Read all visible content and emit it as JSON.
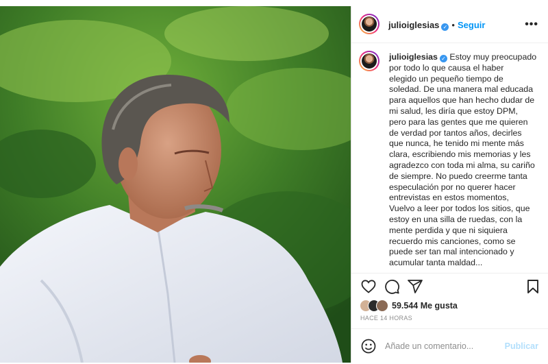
{
  "header": {
    "username": "julioiglesias",
    "separator": "•",
    "follow_label": "Seguir",
    "more_icon": "more-options-icon"
  },
  "caption": {
    "username": "julioiglesias",
    "text": "Estoy muy preocupado\npor todo lo que causa el haber\nelegido un pequeño tiempo de\nsoledad. De una manera mal educada\npara aquellos que han hecho dudar de\nmi salud, les diría que estoy DPM,\npero para las gentes que me quieren\nde verdad por tantos años, decirles\nque nunca, he tenido mi mente más\nclara, escribiendo mis memorias y les\nagradezco con toda mi alma, su cariño\nde siempre. No puedo creerme tanta\nespeculación por no querer hacer\nentrevistas en estos momentos,\nVuelvo a leer por todos los sitios, que\nestoy en una silla de ruedas, con la\nmente perdida y que ni siquiera\nrecuerdo mis canciones, como se\npuede ser tan mal intencionado y\nacumular tanta maldad..."
  },
  "actions": {
    "icons": [
      "heart-icon",
      "comment-icon",
      "share-icon",
      "bookmark-icon"
    ]
  },
  "likes": {
    "text": "59.544 Me gusta"
  },
  "timestamp": "HACE 14 HORAS",
  "comment_box": {
    "placeholder": "Añade un comentario...",
    "publish_label": "Publicar"
  },
  "colors": {
    "accent": "#0095f6",
    "verified": "#3897f0",
    "text": "#262626",
    "muted": "#8e8e8e"
  }
}
